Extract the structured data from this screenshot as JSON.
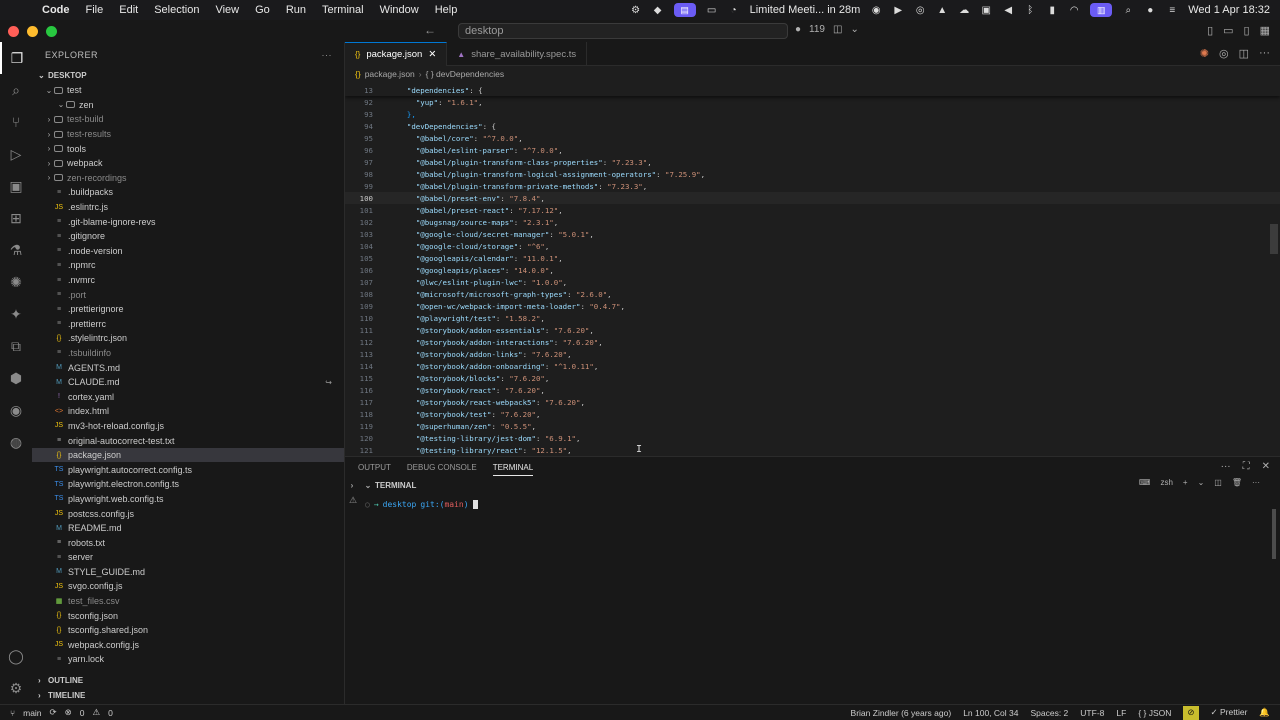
{
  "menubar": {
    "app_name": "Code",
    "items": [
      "File",
      "Edit",
      "Selection",
      "View",
      "Go",
      "Run",
      "Terminal",
      "Window",
      "Help"
    ],
    "meeting": "Limited Meeti... in 28m",
    "clock": "Wed 1 Apr 18:32"
  },
  "titlebar": {
    "back": "←",
    "forward": "→",
    "search_text": "desktop",
    "source_control_count": "119"
  },
  "sidebar": {
    "title": "EXPLORER",
    "root": "DESKTOP",
    "items": [
      {
        "label": "test",
        "type": "folder",
        "open": true
      },
      {
        "label": "zen",
        "type": "folder",
        "open": true
      },
      {
        "label": "test-build",
        "type": "folder",
        "ignored": true
      },
      {
        "label": "test-results",
        "type": "folder",
        "ignored": true
      },
      {
        "label": "tools",
        "type": "folder"
      },
      {
        "label": "webpack",
        "type": "folder"
      },
      {
        "label": "zen-recordings",
        "type": "folder",
        "ignored": true
      },
      {
        "label": ".buildpacks",
        "type": "file"
      },
      {
        "label": ".eslintrc.js",
        "type": "file"
      },
      {
        "label": ".git-blame-ignore-revs",
        "type": "file"
      },
      {
        "label": ".gitignore",
        "type": "file"
      },
      {
        "label": ".node-version",
        "type": "file"
      },
      {
        "label": ".npmrc",
        "type": "file"
      },
      {
        "label": ".nvmrc",
        "type": "file"
      },
      {
        "label": ".port",
        "type": "file",
        "ignored": true
      },
      {
        "label": ".prettierignore",
        "type": "file"
      },
      {
        "label": ".prettierrc",
        "type": "file"
      },
      {
        "label": ".stylelintrc.json",
        "type": "file"
      },
      {
        "label": ".tsbuildinfo",
        "type": "file",
        "ignored": true
      },
      {
        "label": "AGENTS.md",
        "type": "file"
      },
      {
        "label": "CLAUDE.md",
        "type": "file",
        "badge": "↪"
      },
      {
        "label": "cortex.yaml",
        "type": "file"
      },
      {
        "label": "index.html",
        "type": "file"
      },
      {
        "label": "mv3-hot-reload.config.js",
        "type": "file"
      },
      {
        "label": "original-autocorrect-test.txt",
        "type": "file"
      },
      {
        "label": "package.json",
        "type": "file",
        "selected": true
      },
      {
        "label": "playwright.autocorrect.config.ts",
        "type": "file"
      },
      {
        "label": "playwright.electron.config.ts",
        "type": "file"
      },
      {
        "label": "playwright.web.config.ts",
        "type": "file"
      },
      {
        "label": "postcss.config.js",
        "type": "file"
      },
      {
        "label": "README.md",
        "type": "file"
      },
      {
        "label": "robots.txt",
        "type": "file"
      },
      {
        "label": "server",
        "type": "file"
      },
      {
        "label": "STYLE_GUIDE.md",
        "type": "file"
      },
      {
        "label": "svgo.config.js",
        "type": "file"
      },
      {
        "label": "test_files.csv",
        "type": "file",
        "ignored": true
      },
      {
        "label": "tsconfig.json",
        "type": "file"
      },
      {
        "label": "tsconfig.shared.json",
        "type": "file"
      },
      {
        "label": "webpack.config.js",
        "type": "file"
      },
      {
        "label": "yarn.lock",
        "type": "file"
      }
    ],
    "outline": "OUTLINE",
    "timeline": "TIMELINE"
  },
  "editor": {
    "tabs": [
      {
        "label": "package.json",
        "active": true
      },
      {
        "label": "share_availability.spec.ts",
        "active": false
      }
    ],
    "breadcrumb": [
      "package.json",
      "{ } devDependencies"
    ],
    "sticky": {
      "ln": "13",
      "key": "\"dependencies\"",
      "rest": ": {"
    },
    "lines": [
      {
        "ln": "92",
        "key": "\"yup\"",
        "val": "\"1.6.1\"",
        "indent": 4
      },
      {
        "ln": "93",
        "raw": "},",
        "indent": 2
      },
      {
        "ln": "94",
        "key": "\"devDependencies\"",
        "raw_after": ": {",
        "indent": 2
      },
      {
        "ln": "95",
        "key": "\"@babel/core\"",
        "val": "\"^7.0.0\"",
        "indent": 4
      },
      {
        "ln": "96",
        "key": "\"@babel/eslint-parser\"",
        "val": "\"^7.0.0\"",
        "indent": 4
      },
      {
        "ln": "97",
        "key": "\"@babel/plugin-transform-class-properties\"",
        "val": "\"7.23.3\"",
        "indent": 4
      },
      {
        "ln": "98",
        "key": "\"@babel/plugin-transform-logical-assignment-operators\"",
        "val": "\"7.25.9\"",
        "indent": 4
      },
      {
        "ln": "99",
        "key": "\"@babel/plugin-transform-private-methods\"",
        "val": "\"7.23.3\"",
        "indent": 4
      },
      {
        "ln": "100",
        "key": "\"@babel/preset-env\"",
        "val": "\"7.8.4\"",
        "indent": 4,
        "current": true
      },
      {
        "ln": "101",
        "key": "\"@babel/preset-react\"",
        "val": "\"7.17.12\"",
        "indent": 4
      },
      {
        "ln": "102",
        "key": "\"@bugsnag/source-maps\"",
        "val": "\"2.3.1\"",
        "indent": 4
      },
      {
        "ln": "103",
        "key": "\"@google-cloud/secret-manager\"",
        "val": "\"5.0.1\"",
        "indent": 4
      },
      {
        "ln": "104",
        "key": "\"@google-cloud/storage\"",
        "val": "\"^6\"",
        "indent": 4
      },
      {
        "ln": "105",
        "key": "\"@googleapis/calendar\"",
        "val": "\"11.0.1\"",
        "indent": 4
      },
      {
        "ln": "106",
        "key": "\"@googleapis/places\"",
        "val": "\"14.0.0\"",
        "indent": 4
      },
      {
        "ln": "107",
        "key": "\"@lwc/eslint-plugin-lwc\"",
        "val": "\"1.0.0\"",
        "indent": 4
      },
      {
        "ln": "108",
        "key": "\"@microsoft/microsoft-graph-types\"",
        "val": "\"2.6.0\"",
        "indent": 4
      },
      {
        "ln": "109",
        "key": "\"@open-wc/webpack-import-meta-loader\"",
        "val": "\"0.4.7\"",
        "indent": 4
      },
      {
        "ln": "110",
        "key": "\"@playwright/test\"",
        "val": "\"1.58.2\"",
        "indent": 4
      },
      {
        "ln": "111",
        "key": "\"@storybook/addon-essentials\"",
        "val": "\"7.6.20\"",
        "indent": 4
      },
      {
        "ln": "112",
        "key": "\"@storybook/addon-interactions\"",
        "val": "\"7.6.20\"",
        "indent": 4
      },
      {
        "ln": "113",
        "key": "\"@storybook/addon-links\"",
        "val": "\"7.6.20\"",
        "indent": 4
      },
      {
        "ln": "114",
        "key": "\"@storybook/addon-onboarding\"",
        "val": "\"^1.0.11\"",
        "indent": 4
      },
      {
        "ln": "115",
        "key": "\"@storybook/blocks\"",
        "val": "\"7.6.20\"",
        "indent": 4
      },
      {
        "ln": "116",
        "key": "\"@storybook/react\"",
        "val": "\"7.6.20\"",
        "indent": 4
      },
      {
        "ln": "117",
        "key": "\"@storybook/react-webpack5\"",
        "val": "\"7.6.20\"",
        "indent": 4
      },
      {
        "ln": "118",
        "key": "\"@storybook/test\"",
        "val": "\"7.6.20\"",
        "indent": 4
      },
      {
        "ln": "119",
        "key": "\"@superhuman/zen\"",
        "val": "\"0.5.5\"",
        "indent": 4
      },
      {
        "ln": "120",
        "key": "\"@testing-library/jest-dom\"",
        "val": "\"6.9.1\"",
        "indent": 4
      },
      {
        "ln": "121",
        "key": "\"@testing-library/react\"",
        "val": "\"12.1.5\"",
        "indent": 4
      }
    ]
  },
  "panel": {
    "tabs": [
      "OUTPUT",
      "DEBUG CONSOLE",
      "TERMINAL"
    ],
    "active_tab": "TERMINAL",
    "section": "TERMINAL",
    "shell": "zsh",
    "prompt": {
      "arrow": "→",
      "dir": "desktop",
      "git": "git:(",
      "branch": "main",
      "close": ")"
    }
  },
  "statusbar": {
    "branch": "main",
    "errors": "0",
    "warnings": "0",
    "blame": "Brian Zindler (6 years ago)",
    "position": "Ln 100, Col 34",
    "spaces": "Spaces: 2",
    "encoding": "UTF-8",
    "eol": "LF",
    "language": "{ } JSON",
    "formatter": "✓ Prettier"
  }
}
